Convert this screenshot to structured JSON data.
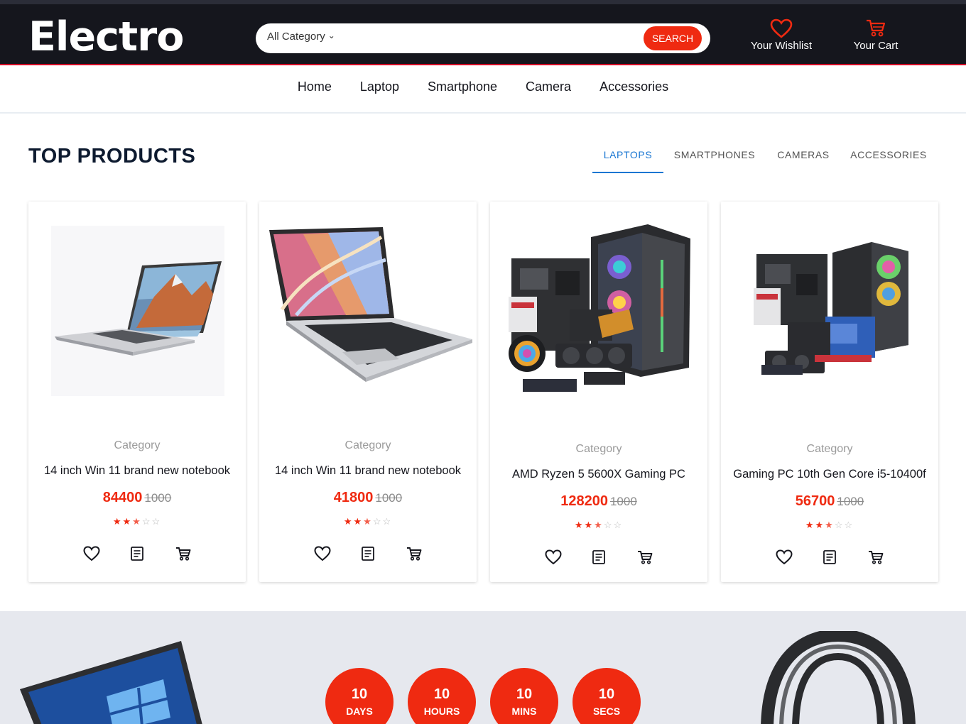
{
  "header": {
    "logo": "Electro",
    "search": {
      "category": "All Category",
      "button": "SEARCH",
      "placeholder": ""
    },
    "wishlist_label": "Your Wishlist",
    "cart_label": "Your Cart"
  },
  "nav": {
    "items": [
      "Home",
      "Laptop",
      "Smartphone",
      "Camera",
      "Accessories"
    ]
  },
  "top_products": {
    "title": "TOP PRODUCTS",
    "tabs": [
      "LAPTOPS",
      "SMARTPHONES",
      "CAMERAS",
      "ACCESSORIES"
    ],
    "active_tab": "LAPTOPS",
    "products": [
      {
        "category": "Category",
        "name": "14 inch Win 11 brand new notebook",
        "price": "84400",
        "old_price": "1000",
        "rating": 2.5
      },
      {
        "category": "Category",
        "name": "14 inch Win 11 brand new notebook",
        "price": "41800",
        "old_price": "1000",
        "rating": 2.5
      },
      {
        "category": "Category",
        "name": "AMD Ryzen 5 5600X Gaming PC",
        "price": "128200",
        "old_price": "1000",
        "rating": 2.5
      },
      {
        "category": "Category",
        "name": "Gaming PC 10th Gen Core i5-10400f",
        "price": "56700",
        "old_price": "1000",
        "rating": 2.5
      }
    ]
  },
  "deal": {
    "timers": [
      {
        "value": "10",
        "unit": "DAYS"
      },
      {
        "value": "10",
        "unit": "HOURS"
      },
      {
        "value": "10",
        "unit": "MINS"
      },
      {
        "value": "10",
        "unit": "SECS"
      }
    ]
  },
  "colors": {
    "header_bg": "#15161d",
    "accent": "#ef2a11",
    "active_tab": "#1976d2",
    "deal_bg": "#e6e8ee"
  },
  "icons": [
    "heart-icon",
    "cart-icon",
    "chevron-down-icon",
    "wishlist-icon",
    "quick-view-icon",
    "add-to-cart-icon"
  ]
}
